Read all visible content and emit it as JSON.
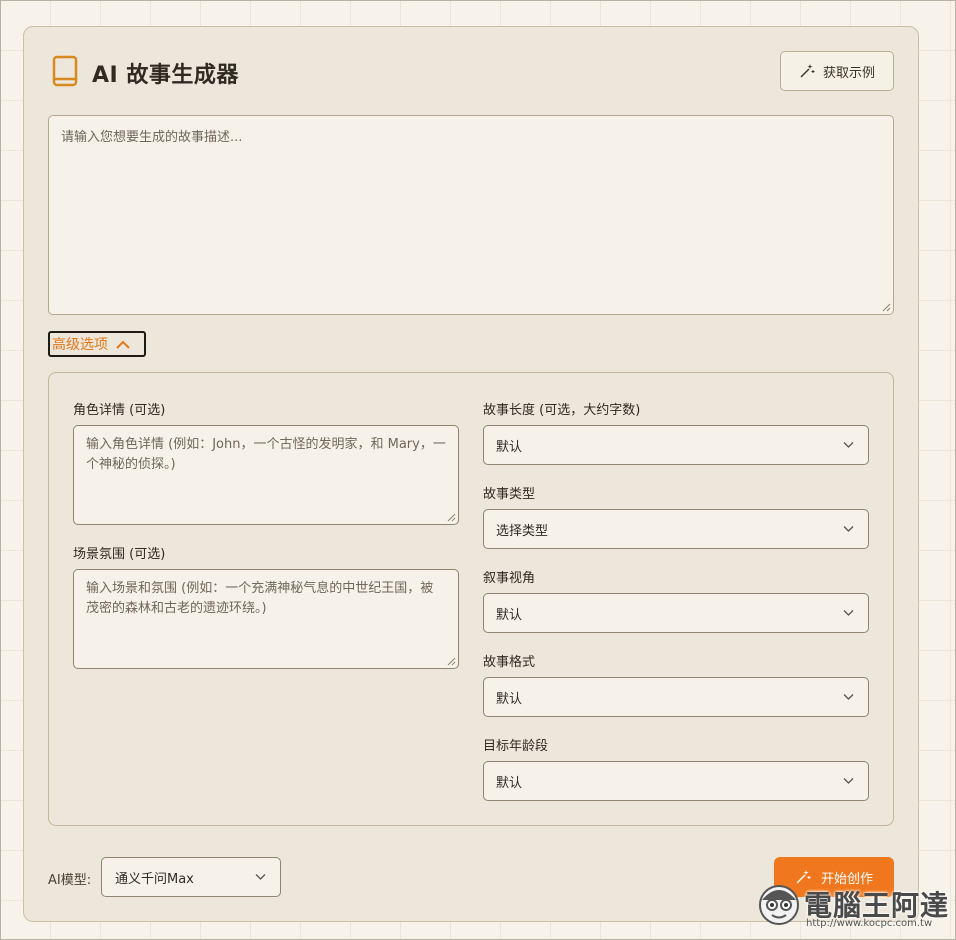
{
  "header": {
    "title": "AI 故事生成器",
    "example_button": "获取示例"
  },
  "prompt": {
    "placeholder": "请输入您想要生成的故事描述..."
  },
  "advanced": {
    "toggle_label": "高级选项",
    "character": {
      "label": "角色详情 (可选)",
      "placeholder": "输入角色详情 (例如：John，一个古怪的发明家，和 Mary，一个神秘的侦探。)"
    },
    "setting": {
      "label": "场景氛围 (可选)",
      "placeholder": "输入场景和氛围 (例如：一个充满神秘气息的中世纪王国，被茂密的森林和古老的遗迹环绕。)"
    },
    "length": {
      "label": "故事长度 (可选，大约字数)",
      "value": "默认"
    },
    "type": {
      "label": "故事类型",
      "value": "选择类型"
    },
    "perspective": {
      "label": "叙事视角",
      "value": "默认"
    },
    "format": {
      "label": "故事格式",
      "value": "默认"
    },
    "age": {
      "label": "目标年龄段",
      "value": "默认"
    }
  },
  "footer": {
    "model_label": "AI模型:",
    "model_value": "通义千问Max",
    "start_button": "开始创作"
  },
  "watermark": {
    "text": "電腦王阿達",
    "url": "http://www.kocpc.com.tw"
  },
  "colors": {
    "accent": "#f0771d",
    "card_bg": "#ede6da",
    "page_bg": "#f7f3ea"
  },
  "icons": {
    "title": "book-icon",
    "example": "magic-wand-icon",
    "advanced": "chevron-up-icon",
    "select": "chevron-down-icon",
    "start": "magic-wand-icon"
  }
}
